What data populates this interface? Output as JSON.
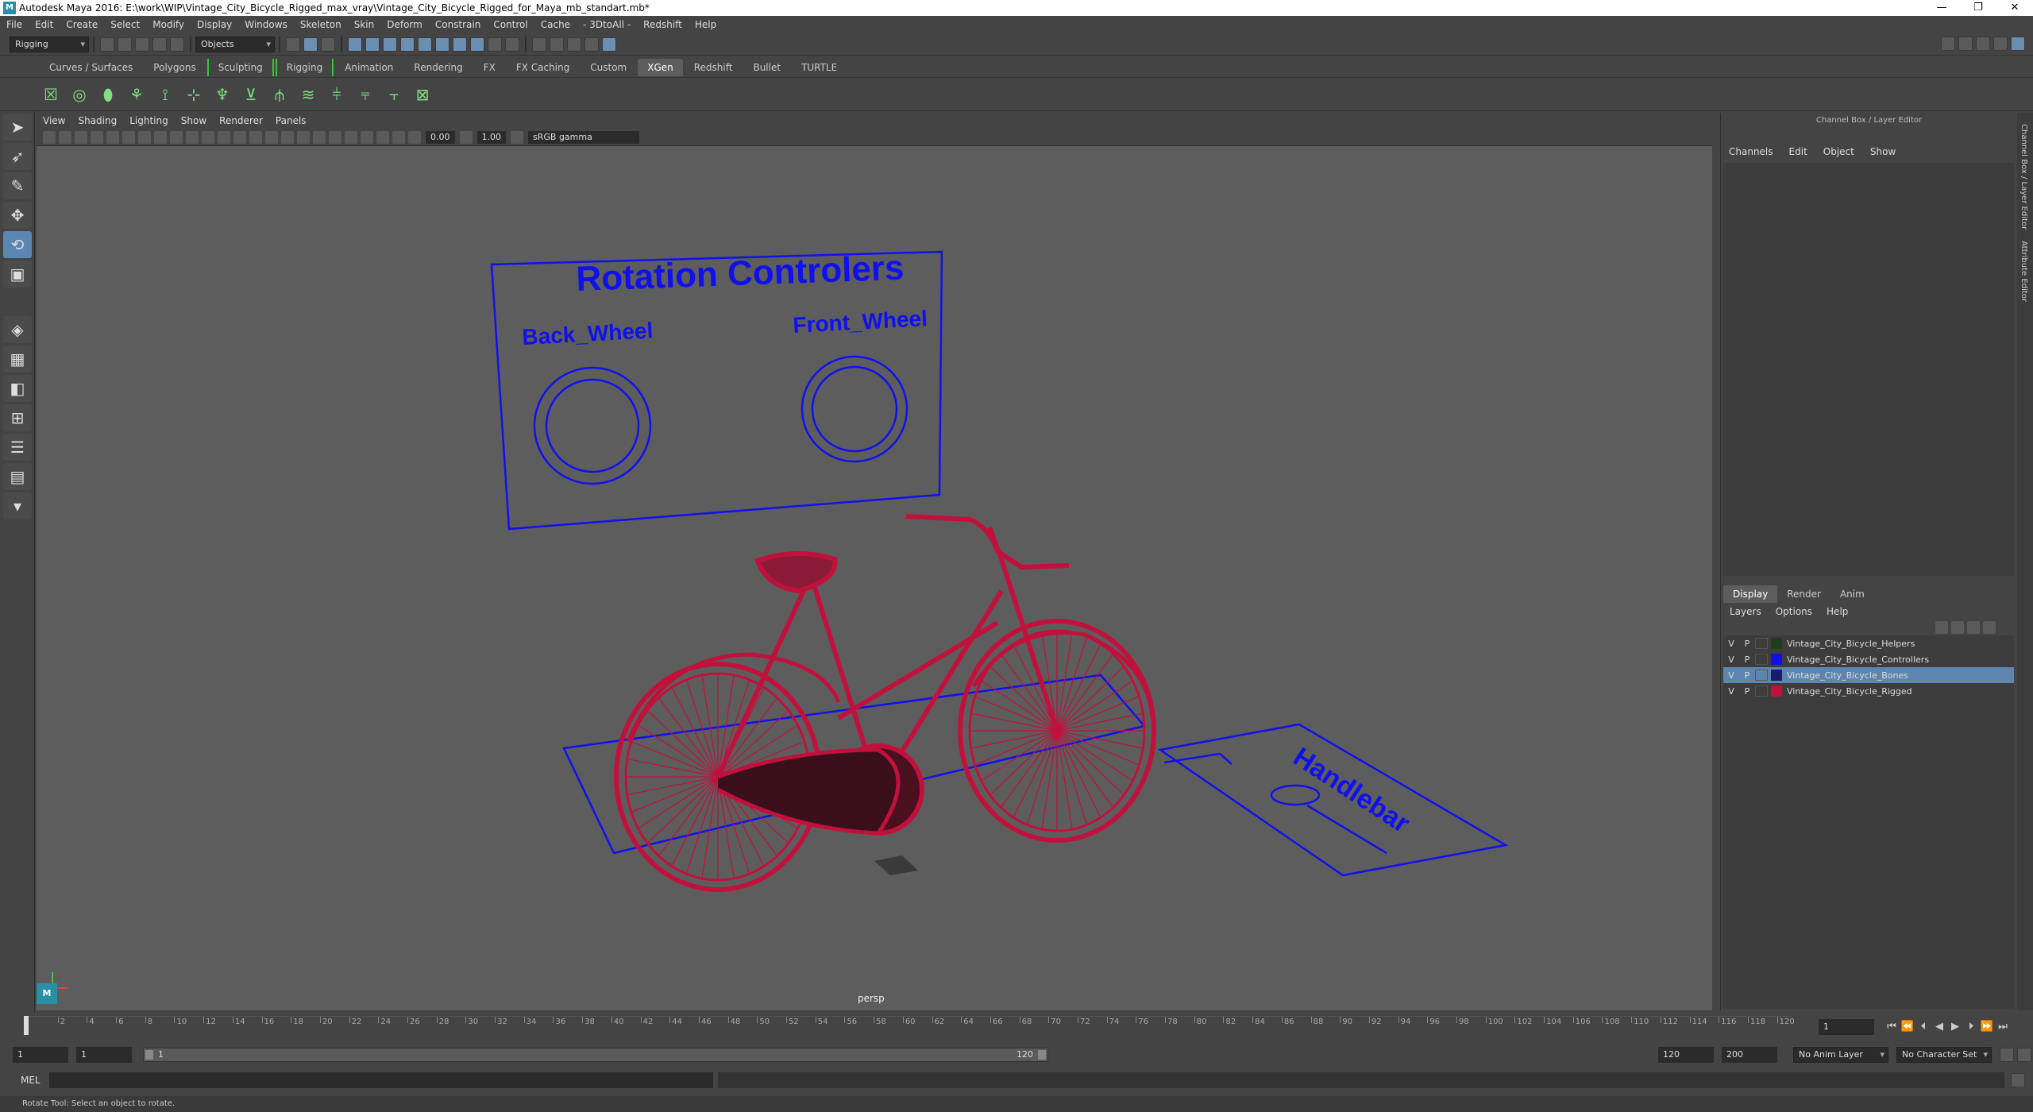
{
  "window": {
    "title": "Autodesk Maya 2016: E:\\work\\WIP\\Vintage_City_Bicycle_Rigged_max_vray\\Vintage_City_Bicycle_Rigged_for_Maya_mb_standart.mb*",
    "logo_letter": "M",
    "minimize": "—",
    "restore": "❐",
    "close": "✕"
  },
  "menubar": [
    "File",
    "Edit",
    "Create",
    "Select",
    "Modify",
    "Display",
    "Windows",
    "Skeleton",
    "Skin",
    "Deform",
    "Constrain",
    "Control",
    "Cache",
    "- 3DtoAll -",
    "Redshift",
    "Help"
  ],
  "statusline": {
    "menuset": "Rigging",
    "selection_mode": "Objects"
  },
  "shelf_tabs": [
    {
      "label": "Curves / Surfaces",
      "active": false,
      "bracket": false
    },
    {
      "label": "Polygons",
      "active": false,
      "bracket": false
    },
    {
      "label": "Sculpting",
      "active": false,
      "bracket": true
    },
    {
      "label": "Rigging",
      "active": false,
      "bracket": true
    },
    {
      "label": "Animation",
      "active": false,
      "bracket": false
    },
    {
      "label": "Rendering",
      "active": false,
      "bracket": false
    },
    {
      "label": "FX",
      "active": false,
      "bracket": false
    },
    {
      "label": "FX Caching",
      "active": false,
      "bracket": false
    },
    {
      "label": "Custom",
      "active": false,
      "bracket": false
    },
    {
      "label": "XGen",
      "active": true,
      "bracket": false
    },
    {
      "label": "Redshift",
      "active": false,
      "bracket": false
    },
    {
      "label": "Bullet",
      "active": false,
      "bracket": false
    },
    {
      "label": "TURTLE",
      "active": false,
      "bracket": false
    }
  ],
  "viewport": {
    "menu": [
      "View",
      "Shading",
      "Lighting",
      "Show",
      "Renderer",
      "Panels"
    ],
    "exposure": "0.00",
    "gamma": "1.00",
    "color_space": "sRGB gamma",
    "camera": "persp",
    "labels": {
      "rotation_title": "Rotation Controlers",
      "back_wheel": "Back_Wheel",
      "front_wheel": "Front_Wheel",
      "handlebar": "Handlebar"
    },
    "colors": {
      "controller": "#1010ee",
      "bicycle": "#c2103c",
      "bg": "#5d5d5d"
    }
  },
  "channel_box": {
    "title": "Channel Box / Layer Editor",
    "menu": [
      "Channels",
      "Edit",
      "Object",
      "Show"
    ]
  },
  "layer_editor": {
    "tabs": [
      {
        "label": "Display",
        "active": true
      },
      {
        "label": "Render",
        "active": false
      },
      {
        "label": "Anim",
        "active": false
      }
    ],
    "menu": [
      "Layers",
      "Options",
      "Help"
    ],
    "layers": [
      {
        "v": "V",
        "p": "P",
        "color": "#1a3f1a",
        "name": "Vintage_City_Bicycle_Helpers",
        "selected": false
      },
      {
        "v": "V",
        "p": "P",
        "color": "#1010ee",
        "name": "Vintage_City_Bicycle_Controllers",
        "selected": false
      },
      {
        "v": "V",
        "p": "P",
        "color": "#1a1a6e",
        "name": "Vintage_City_Bicycle_Bones",
        "selected": true
      },
      {
        "v": "V",
        "p": "P",
        "color": "#c2103c",
        "name": "Vintage_City_Bicycle_Rigged",
        "selected": false
      }
    ]
  },
  "side_tabs": [
    "Channel Box / Layer Editor",
    "Attribute Editor"
  ],
  "time_slider": {
    "current_frame": "1",
    "ticks": [
      2,
      4,
      6,
      8,
      10,
      12,
      14,
      16,
      18,
      20,
      22,
      24,
      26,
      28,
      30,
      32,
      34,
      36,
      38,
      40,
      42,
      44,
      46,
      48,
      50,
      52,
      54,
      56,
      58,
      60,
      62,
      64,
      66,
      68,
      70,
      72,
      74,
      76,
      78,
      80,
      82,
      84,
      86,
      88,
      90,
      92,
      94,
      96,
      98,
      100,
      102,
      104,
      106,
      108,
      110,
      112,
      114,
      116,
      118,
      120
    ]
  },
  "range_slider": {
    "start": "1",
    "playback_start": "1",
    "range_start_label": "1",
    "range_end_label": "120",
    "playback_end": "120",
    "end": "200",
    "anim_layer": "No Anim Layer",
    "character_set": "No Character Set"
  },
  "command_line": {
    "label": "MEL"
  },
  "help_line": "Rotate Tool: Select an object to rotate."
}
